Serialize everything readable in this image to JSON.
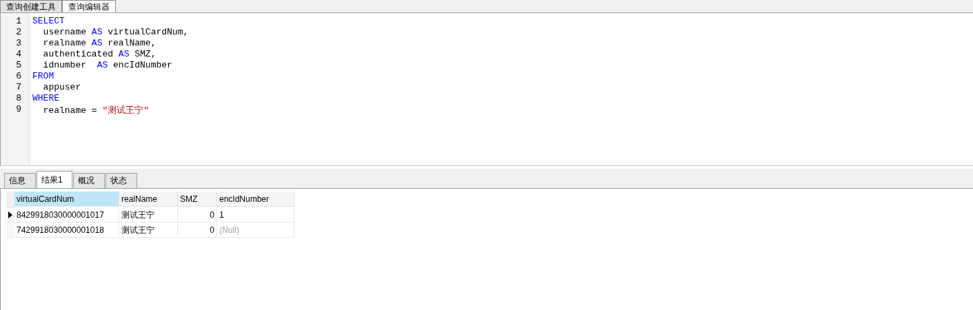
{
  "top_tabs": [
    {
      "label": "查询创建工具",
      "selected": false
    },
    {
      "label": "查询编辑器",
      "selected": true
    }
  ],
  "editor": {
    "lines": [
      {
        "number": "1",
        "tokens": [
          {
            "kind": "keyword",
            "text": "SELECT"
          }
        ]
      },
      {
        "number": "2",
        "tokens": [
          {
            "kind": "plain",
            "text": "  username "
          },
          {
            "kind": "keyword",
            "text": "AS"
          },
          {
            "kind": "plain",
            "text": " virtualCardNum,"
          }
        ]
      },
      {
        "number": "3",
        "tokens": [
          {
            "kind": "plain",
            "text": "  realname "
          },
          {
            "kind": "keyword",
            "text": "AS"
          },
          {
            "kind": "plain",
            "text": " realName,"
          }
        ]
      },
      {
        "number": "4",
        "tokens": [
          {
            "kind": "plain",
            "text": "  authenticated "
          },
          {
            "kind": "keyword",
            "text": "AS"
          },
          {
            "kind": "plain",
            "text": " SMZ,"
          }
        ]
      },
      {
        "number": "5",
        "tokens": [
          {
            "kind": "plain",
            "text": "  idnumber  "
          },
          {
            "kind": "keyword",
            "text": "AS"
          },
          {
            "kind": "plain",
            "text": " encIdNumber"
          }
        ]
      },
      {
        "number": "6",
        "tokens": [
          {
            "kind": "keyword",
            "text": "FROM"
          }
        ]
      },
      {
        "number": "7",
        "tokens": [
          {
            "kind": "plain",
            "text": "  appuser"
          }
        ]
      },
      {
        "number": "8",
        "tokens": [
          {
            "kind": "keyword",
            "text": "WHERE"
          }
        ]
      },
      {
        "number": "9",
        "tokens": [
          {
            "kind": "plain",
            "text": "  realname = "
          },
          {
            "kind": "string",
            "text": "\"测试王宁\""
          }
        ]
      }
    ]
  },
  "result_tabs": [
    {
      "label": "信息",
      "selected": false
    },
    {
      "label": "结果1",
      "selected": true
    },
    {
      "label": "概况",
      "selected": false
    },
    {
      "label": "状态",
      "selected": false
    }
  ],
  "table": {
    "columns": [
      {
        "label": "virtualCardNum",
        "kind": "text",
        "selected": true
      },
      {
        "label": "realName",
        "kind": "text",
        "selected": false
      },
      {
        "label": "SMZ",
        "kind": "number",
        "selected": false
      },
      {
        "label": "encIdNumber",
        "kind": "text",
        "selected": false
      }
    ],
    "rows": [
      {
        "current": true,
        "cells": [
          {
            "kind": "value",
            "text": "8429918030000001017"
          },
          {
            "kind": "value",
            "text": "测试王宁"
          },
          {
            "kind": "value",
            "text": "0"
          },
          {
            "kind": "value",
            "text": "1"
          }
        ]
      },
      {
        "current": false,
        "cells": [
          {
            "kind": "value",
            "text": "7429918030000001018"
          },
          {
            "kind": "value",
            "text": "测试王宁"
          },
          {
            "kind": "value",
            "text": "0"
          },
          {
            "kind": "null",
            "text": "(Null)"
          }
        ]
      }
    ]
  }
}
